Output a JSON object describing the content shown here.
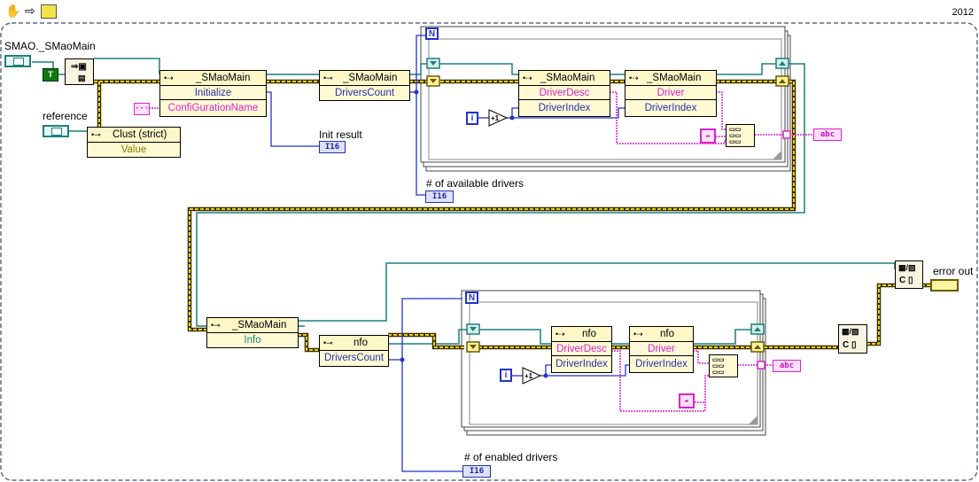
{
  "version": "2012",
  "labels": {
    "smao_main": "SMAO._SMaoMain",
    "reference": "reference",
    "init_result": "Init result",
    "available_drivers": "# of available drivers",
    "enabled_drivers": "# of enabled drivers",
    "error_out": "error out"
  },
  "nodes": {
    "initialize": {
      "name": "_SMaoMain",
      "method": "Initialize",
      "param": "ConfiGurationName"
    },
    "drivers_count": {
      "name": "_SMaoMain",
      "prop": "DriversCount"
    },
    "driver_desc": {
      "name": "_SMaoMain",
      "prop1": "DriverDesc",
      "prop2": "DriverIndex"
    },
    "driver": {
      "name": "_SMaoMain",
      "prop1": "Driver",
      "prop2": "DriverIndex"
    },
    "clust": {
      "name": "Clust (strict)",
      "prop": "Value"
    },
    "info": {
      "name": "_SMaoMain",
      "prop": "Info"
    },
    "nfo_count": {
      "name": "nfo",
      "prop": "DriversCount"
    },
    "nfo_desc": {
      "name": "nfo",
      "prop1": "DriverDesc",
      "prop2": "DriverIndex"
    },
    "nfo_driver": {
      "name": "nfo",
      "prop1": "Driver",
      "prop2": "DriverIndex"
    }
  },
  "glyphs": {
    "loop_count": "N",
    "iter": "i",
    "plus": "+1",
    "i16": "I16",
    "abc": "abc",
    "true_const": "T",
    "dash": "-"
  },
  "colors": {
    "refnum_wire": "#1e7f7f",
    "error_wire_a": "#c9b400",
    "error_wire_b": "#3a2d00",
    "int_wire": "#2233cc",
    "string_wire": "#dd22cc",
    "node_bg": "#fff9d4"
  }
}
